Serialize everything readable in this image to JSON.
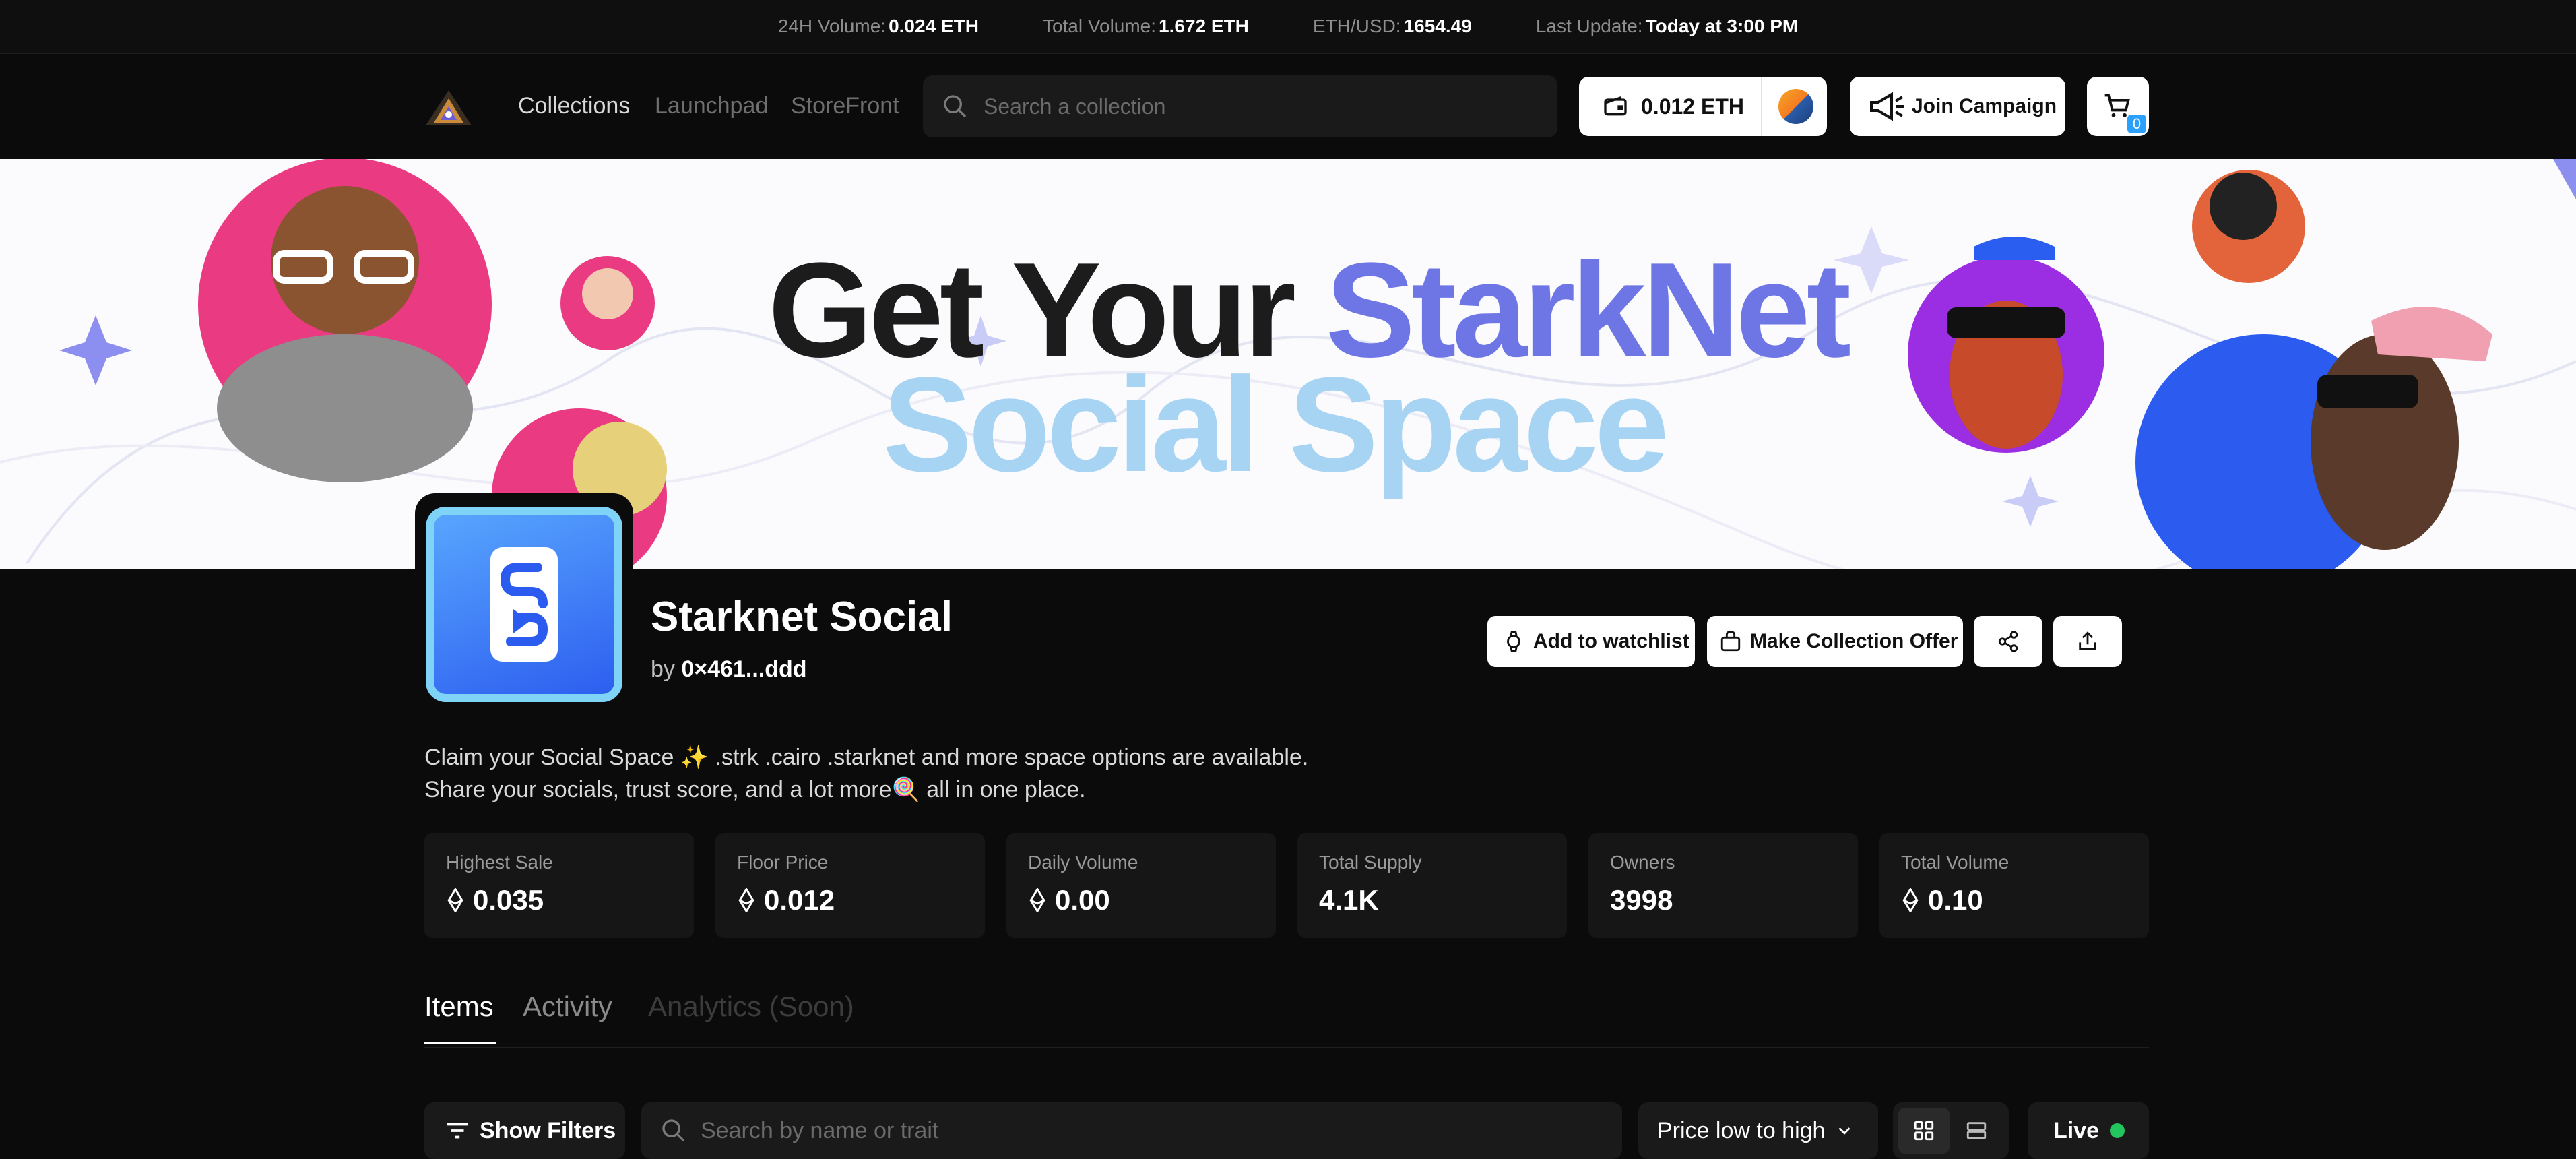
{
  "topbar": {
    "items": [
      {
        "label": "24H Volume:",
        "value": "0.024 ETH"
      },
      {
        "label": "Total Volume:",
        "value": "1.672 ETH"
      },
      {
        "label": "ETH/USD:",
        "value": "1654.49"
      },
      {
        "label": "Last Update:",
        "value": "Today at 3:00 PM"
      }
    ]
  },
  "nav": {
    "links": [
      "Collections",
      "Launchpad",
      "StoreFront"
    ],
    "search_placeholder": "Search a collection",
    "wallet_balance": "0.012 ETH",
    "campaign_label": "Join Campaign",
    "cart_count": "0"
  },
  "banner": {
    "line1_a": "Get Your",
    "line1_b": "StarkNet",
    "line2": "Social Space"
  },
  "collection": {
    "name": "Starknet Social",
    "by_label": "by",
    "creator": "0×461...ddd",
    "actions": {
      "watchlist": "Add to watchlist",
      "offer": "Make Collection Offer"
    },
    "description_line1": "Claim your Social Space ✨ .strk .cairo .starknet and more space options are available.",
    "description_line2": "Share your socials, trust score, and a lot more🍭 all in one place."
  },
  "stats": [
    {
      "label": "Highest Sale",
      "value": "0.035",
      "eth": true
    },
    {
      "label": "Floor Price",
      "value": "0.012",
      "eth": true
    },
    {
      "label": "Daily Volume",
      "value": "0.00",
      "eth": true
    },
    {
      "label": "Total Supply",
      "value": "4.1K",
      "eth": false
    },
    {
      "label": "Owners",
      "value": "3998",
      "eth": false
    },
    {
      "label": "Total Volume",
      "value": "0.10",
      "eth": true
    }
  ],
  "tabs": {
    "items": "Items",
    "activity": "Activity",
    "analytics": "Analytics (Soon)"
  },
  "toolbar": {
    "filters_label": "Show Filters",
    "search_placeholder": "Search by name or trait",
    "sort_label": "Price low to high",
    "live_label": "Live"
  },
  "colors": {
    "live_dot": "#22c55e",
    "cart_badge": "#2aa1ff",
    "banner_accent": "#6e76e6"
  }
}
